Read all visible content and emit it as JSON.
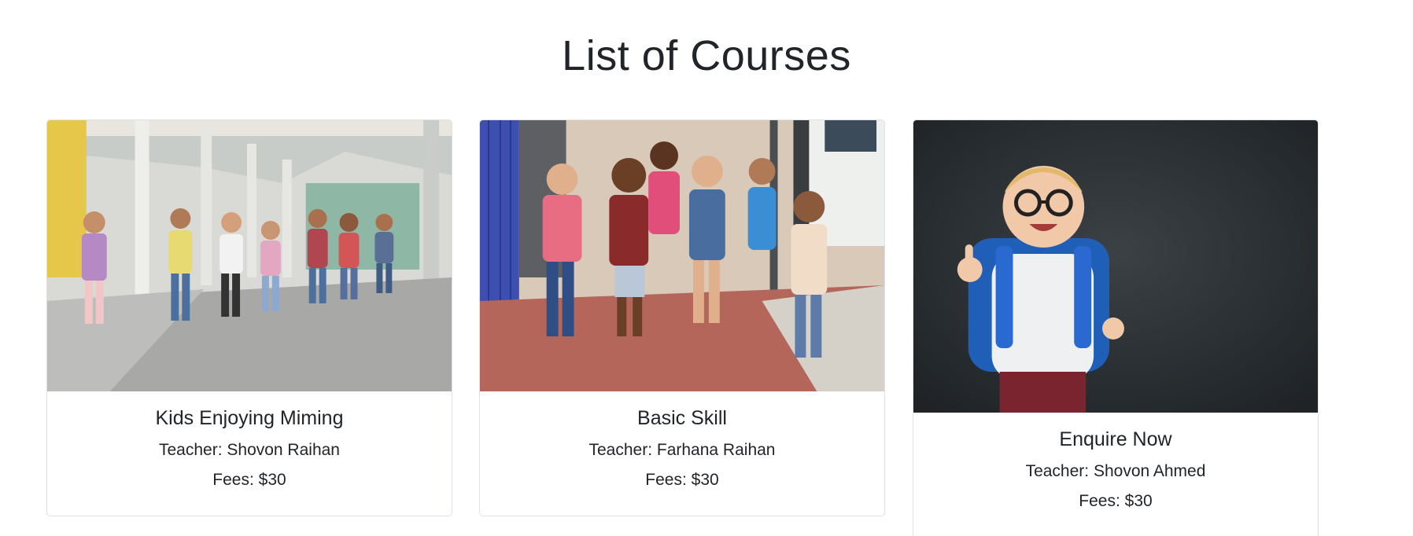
{
  "page": {
    "title": "List of Courses"
  },
  "courses": [
    {
      "title": "Kids Enjoying Miming",
      "teacher": "Teacher: Shovon Raihan",
      "fees": "Fees: $30",
      "image_subject": "children running down a school corridor"
    },
    {
      "title": "Basic Skill",
      "teacher": "Teacher: Farhana Raihan",
      "fees": "Fees: $30",
      "image_subject": "children with backpacks running outside school lockers"
    },
    {
      "title": "Enquire Now",
      "teacher": "Teacher: Shovon Ahmed",
      "fees": "Fees: $30",
      "image_subject": "boy with glasses and blue backpack giving thumbs up in front of chalkboard"
    }
  ],
  "colors": {
    "text": "#212529",
    "border": "#dee2e6",
    "chalkboard": "#2b3033"
  }
}
